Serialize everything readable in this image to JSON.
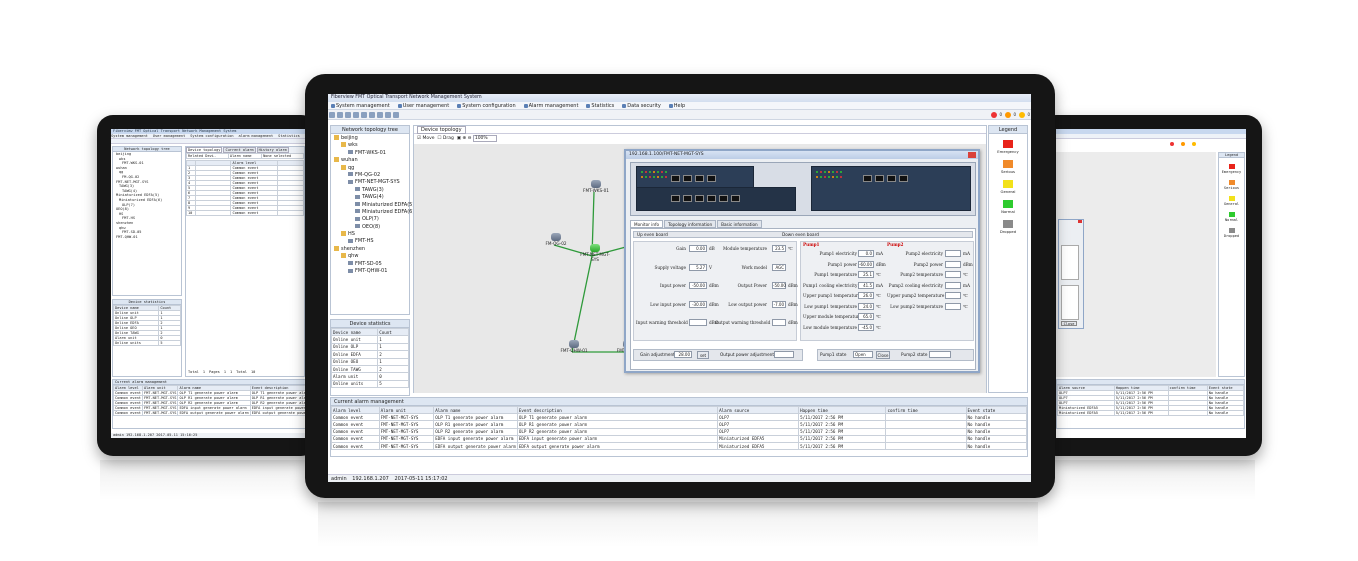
{
  "main": {
    "title": "Fiberview FMT Optical Transport Network Management System",
    "menu": [
      "System management",
      "User management",
      "System configuration",
      "Alarm management",
      "Statistics",
      "Data security",
      "Help"
    ],
    "alarm_counts": [
      "0",
      "0",
      "0"
    ],
    "tree_header": "Network topology tree",
    "tree": [
      {
        "label": "beijing",
        "indent": 0,
        "type": "folder"
      },
      {
        "label": "wks",
        "indent": 1,
        "type": "folder"
      },
      {
        "label": "FMT-WKS-01",
        "indent": 2,
        "type": "device"
      },
      {
        "label": "wuhan",
        "indent": 0,
        "type": "folder"
      },
      {
        "label": "qg",
        "indent": 1,
        "type": "folder"
      },
      {
        "label": "FM-QG-02",
        "indent": 2,
        "type": "device"
      },
      {
        "label": "FMT-NET-MGT-SYS",
        "indent": 2,
        "type": "device"
      },
      {
        "label": "TAWG(3)",
        "indent": 3,
        "type": "device"
      },
      {
        "label": "TAWG(4)",
        "indent": 3,
        "type": "device"
      },
      {
        "label": "Miniaturized EDFA(5)",
        "indent": 3,
        "type": "device"
      },
      {
        "label": "Miniaturized EDFA(6)",
        "indent": 3,
        "type": "device"
      },
      {
        "label": "OLP(7)",
        "indent": 3,
        "type": "device"
      },
      {
        "label": "OEO(8)",
        "indent": 3,
        "type": "device"
      },
      {
        "label": "HS",
        "indent": 1,
        "type": "folder"
      },
      {
        "label": "FMT-HS",
        "indent": 2,
        "type": "device"
      },
      {
        "label": "shenzhen",
        "indent": 0,
        "type": "folder"
      },
      {
        "label": "qhw",
        "indent": 1,
        "type": "folder"
      },
      {
        "label": "FMT-SD-05",
        "indent": 2,
        "type": "device"
      },
      {
        "label": "FMT-QHW-01",
        "indent": 2,
        "type": "device"
      }
    ],
    "tab_label": "Device topology",
    "view_opts": {
      "move": "Move",
      "drag": "Drag",
      "zoom": "100%"
    },
    "nodes": [
      {
        "label": "FMT-WKS-01",
        "pos": "n1"
      },
      {
        "label": "FM-QG-02",
        "pos": "n2"
      },
      {
        "label": "FMT-NET-MGT-SYS",
        "pos": "n3"
      },
      {
        "label": "FMT-HS",
        "pos": "n4"
      },
      {
        "label": "FMT-QHW-01",
        "pos": "n5"
      },
      {
        "label": "FMT-SD-05",
        "pos": "n6"
      }
    ],
    "dialog": {
      "title": "192.168.1.100/FMT-NET-MGT-SYS",
      "tabs": [
        "Monitor info",
        "Topology information",
        "Basic information"
      ],
      "up_board": "Up even board",
      "down_board": "Down even board",
      "left": [
        {
          "label": "Gain",
          "value": "0.00",
          "unit": "dB"
        },
        {
          "label": "Supply voltage",
          "value": "5.27",
          "unit": "V"
        },
        {
          "label": "Input power",
          "value": "-50.00",
          "unit": "dBm"
        },
        {
          "label": "Low input power",
          "value": "-30.00",
          "unit": "dBm"
        },
        {
          "label": "Input warning threshold",
          "value": "",
          "unit": "dBm"
        }
      ],
      "mid": [
        {
          "label": "Module temperature",
          "value": "23.5",
          "unit": "℃"
        },
        {
          "label": "Work model",
          "value": "AGC",
          "unit": ""
        },
        {
          "label": "Output Power",
          "value": "-50.00",
          "unit": "dBm"
        },
        {
          "label": "Low output power",
          "value": "-7.00",
          "unit": "dBm"
        },
        {
          "label": "Output warning threshold",
          "value": "",
          "unit": "dBm"
        }
      ],
      "pump1_title": "Pump1",
      "pump2_title": "Pump2",
      "pump1": [
        {
          "label": "Pump1 electricity",
          "value": "0.0",
          "unit": "mA"
        },
        {
          "label": "Pump1 power",
          "value": "-60.00",
          "unit": "dBm"
        },
        {
          "label": "Pump1 temperature",
          "value": "25.1",
          "unit": "℃"
        },
        {
          "label": "Pump1 cooling electricity",
          "value": "41.5",
          "unit": "mA"
        },
        {
          "label": "Upper pump1 temperature",
          "value": "26.0",
          "unit": "℃"
        },
        {
          "label": "Low pump1 temperature",
          "value": "24.0",
          "unit": "℃"
        },
        {
          "label": "Upper module temperature",
          "value": "65.0",
          "unit": "℃"
        },
        {
          "label": "Low module temperature",
          "value": "-45.0",
          "unit": "℃"
        }
      ],
      "pump2": [
        {
          "label": "Pump2 electricity",
          "value": "",
          "unit": "mA"
        },
        {
          "label": "Pump2 power",
          "value": "",
          "unit": "dBm"
        },
        {
          "label": "Pump2 temperature",
          "value": "",
          "unit": "℃"
        },
        {
          "label": "Pump2 cooling electricity",
          "value": "",
          "unit": "mA"
        },
        {
          "label": "Upper pump2 temperature",
          "value": "",
          "unit": "℃"
        },
        {
          "label": "Low pump2 temperature",
          "value": "",
          "unit": "℃"
        }
      ],
      "gain_adj_label": "Gain adjustment",
      "gain_adj_value": "28.00",
      "set_label": "set",
      "out_adj_label": "Output power adjustment",
      "pump1_state_label": "Pump1 state",
      "pump1_state_value": "Open",
      "close_label": "Close",
      "pump2_state_label": "Pump2 state"
    },
    "legend": {
      "title": "Legend",
      "items": [
        {
          "label": "Emergency",
          "color": "#e8231a"
        },
        {
          "label": "Serious",
          "color": "#f08a2a"
        },
        {
          "label": "General",
          "color": "#f2e11a"
        },
        {
          "label": "Normal",
          "color": "#2ecb2e"
        },
        {
          "label": "Dropped",
          "color": "#8a8a8a"
        }
      ]
    },
    "stats": {
      "title": "Device statistics",
      "cols": [
        "Device name",
        "Count"
      ],
      "rows": [
        [
          "Online unit",
          "1"
        ],
        [
          "Online OLP",
          "1"
        ],
        [
          "Online EDFA",
          "2"
        ],
        [
          "Online OEO",
          "1"
        ],
        [
          "Online TAWG",
          "2"
        ],
        [
          "Alarm unit",
          "0"
        ],
        [
          "Online units",
          "5"
        ]
      ]
    },
    "alarms": {
      "title": "Current alarm management",
      "cols": [
        "Alarm level",
        "Alarm unit",
        "Alarm name",
        "Event description",
        "Alarm source",
        "Happen time",
        "confirm time",
        "Event state"
      ],
      "rows": [
        [
          "Common event",
          "FMT-NET-MGT-SYS",
          "OLP T1 generate power alarm",
          "OLP T1 generate power alarm",
          "OLP7",
          "5/11/2017 2:56 PM",
          "",
          "No handle"
        ],
        [
          "Common event",
          "FMT-NET-MGT-SYS",
          "OLP R1 generate power alarm",
          "OLP R1 generate power alarm",
          "OLP7",
          "5/11/2017 2:56 PM",
          "",
          "No handle"
        ],
        [
          "Common event",
          "FMT-NET-MGT-SYS",
          "OLP R2 generate power alarm",
          "OLP R2 generate power alarm",
          "OLP7",
          "5/11/2017 2:56 PM",
          "",
          "No handle"
        ],
        [
          "Common event",
          "FMT-NET-MGT-SYS",
          "EDFA input generate power alarm",
          "EDFA input generate power alarm",
          "Miniaturized EDFA5",
          "5/11/2017 2:56 PM",
          "",
          "No handle"
        ],
        [
          "Common event",
          "FMT-NET-MGT-SYS",
          "EDFA output generate power alarm",
          "EDFA output generate power alarm",
          "Miniaturized EDFA5",
          "5/11/2017 2:56 PM",
          "",
          "No handle"
        ]
      ]
    },
    "status": {
      "user": "admin",
      "ip": "192.168.1.207",
      "time": "2017-05-11 15:17:02"
    }
  },
  "left_screen": {
    "title": "Fiberview FMT Optical Transport Network Management System",
    "menu": [
      "System management",
      "User management",
      "System configuration",
      "alarm management",
      "Statistics"
    ],
    "tree_header": "Network topology tree",
    "tree": [
      "beijing",
      "wks",
      "FMT-WKS-01",
      "wuhan",
      "qg",
      "FM-QG-02",
      "FMT-NET-MGT-SYS",
      "TAWG(3)",
      "TAWG(4)",
      "Miniaturized EDFA(5)",
      "Miniaturized EDFA(6)",
      "OLP(7)",
      "OEO(8)",
      "HS",
      "FMT-HS",
      "shenzhen",
      "qhw",
      "FMT-SD-05",
      "FMT-QHW-01"
    ],
    "tabs": [
      "Device topology",
      "Current alarm",
      "History alarm"
    ],
    "sub_cols": [
      "Related Devi.",
      "Alarm name",
      "None selected"
    ],
    "grid_cols": [
      "",
      "",
      "Alarm level",
      ""
    ],
    "grid_rows": [
      "1",
      "2",
      "3",
      "4",
      "5",
      "6",
      "7",
      "8",
      "9",
      "10"
    ],
    "grid_level": "Common event",
    "pager": {
      "total": "Total",
      "total_v": "1",
      "pages": "Pages",
      "pages_v": "1",
      "page": "1",
      "total2": "Total",
      "total2_v": "10"
    },
    "stats_title": "Device statistics",
    "stats_cols": [
      "Device name",
      "Count"
    ],
    "stats_rows": [
      [
        "Online unit",
        "1"
      ],
      [
        "Online OLP",
        "1"
      ],
      [
        "Online EDFA",
        "2"
      ],
      [
        "Online OEO",
        "1"
      ],
      [
        "Online TAWG",
        "2"
      ],
      [
        "Alarm unit",
        "0"
      ],
      [
        "Online units",
        "5"
      ]
    ],
    "alarm_title": "Current alarm management",
    "alarm_cols": [
      "Alarm level",
      "Alarm unit",
      "Alarm name",
      "Event description"
    ],
    "alarm_rows": [
      [
        "Common event",
        "FMT-NET-MGT-SYS",
        "OLP T1 generate power alarm",
        "OLP T1 generate power alarm"
      ],
      [
        "Common event",
        "FMT-NET-MGT-SYS",
        "OLP R1 generate power alarm",
        "OLP R1 generate power alarm"
      ],
      [
        "Common event",
        "FMT-NET-MGT-SYS",
        "OLP R2 generate power alarm",
        "OLP R2 generate power alarm"
      ],
      [
        "Common event",
        "FMT-NET-MGT-SYS",
        "EDFA input generate power alarm",
        "EDFA input generate power alarm"
      ],
      [
        "Common event",
        "FMT-NET-MGT-SYS",
        "EDFA output generate power alarm",
        "EDFA output generate power alarm"
      ]
    ],
    "status": "admin 192.168.1.207 2017-05-11 15:16:25"
  },
  "right_screen": {
    "legend_title": "Legend",
    "legend": [
      {
        "label": "Emergency",
        "color": "#e8231a"
      },
      {
        "label": "Serious",
        "color": "#f08a2a"
      },
      {
        "label": "General",
        "color": "#f2e11a"
      },
      {
        "label": "Normal",
        "color": "#2ecb2e"
      },
      {
        "label": "Dropped",
        "color": "#8a8a8a"
      }
    ],
    "close_label": "Close",
    "alarm_cols": [
      "Alarm source",
      "Happen time",
      "confirm time",
      "Event state"
    ],
    "alarm_rows": [
      [
        "OLP7",
        "5/11/2017 2:56 PM",
        "",
        "No handle"
      ],
      [
        "OLP7",
        "5/11/2017 2:56 PM",
        "",
        "No handle"
      ],
      [
        "OLP7",
        "5/11/2017 2:56 PM",
        "",
        "No handle"
      ],
      [
        "Miniaturized EDFA5",
        "5/11/2017 2:56 PM",
        "",
        "No handle"
      ],
      [
        "Miniaturized EDFA5",
        "5/11/2017 2:56 PM",
        "",
        "No handle"
      ]
    ]
  }
}
